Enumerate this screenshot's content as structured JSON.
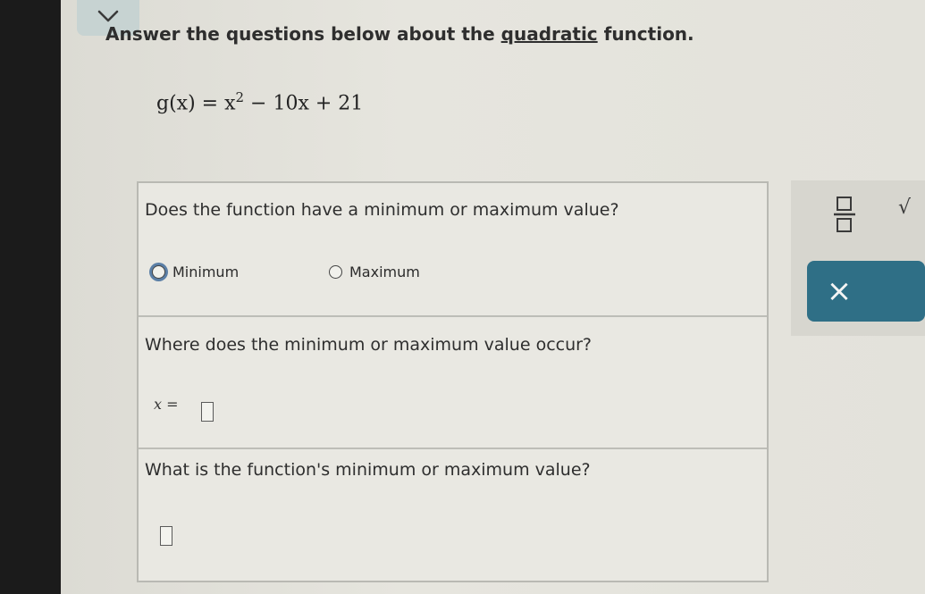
{
  "instruction": {
    "prefix": "Answer the questions below about the ",
    "link": "quadratic",
    "suffix": " function."
  },
  "equation": {
    "lhs": "g(x) = x",
    "exponent": "2",
    "rhs": " − 10x + 21"
  },
  "questions": [
    {
      "text": "Does the function have a minimum or maximum value?",
      "options": [
        "Minimum",
        "Maximum"
      ],
      "selected": null
    },
    {
      "text": "Where does the minimum or maximum value occur?",
      "prefix": "x ="
    },
    {
      "text": "What is the function's minimum or maximum value?"
    }
  ],
  "tools": {
    "sqrt_label": "√",
    "clear_label": "×"
  },
  "icons": {
    "collapse": "chevron-down-icon",
    "fraction": "fraction-icon",
    "sqrt": "square-root-icon",
    "clear": "close-icon"
  },
  "colors": {
    "accent": "#2f6f86",
    "collapse_bg": "#c7d3d2"
  }
}
